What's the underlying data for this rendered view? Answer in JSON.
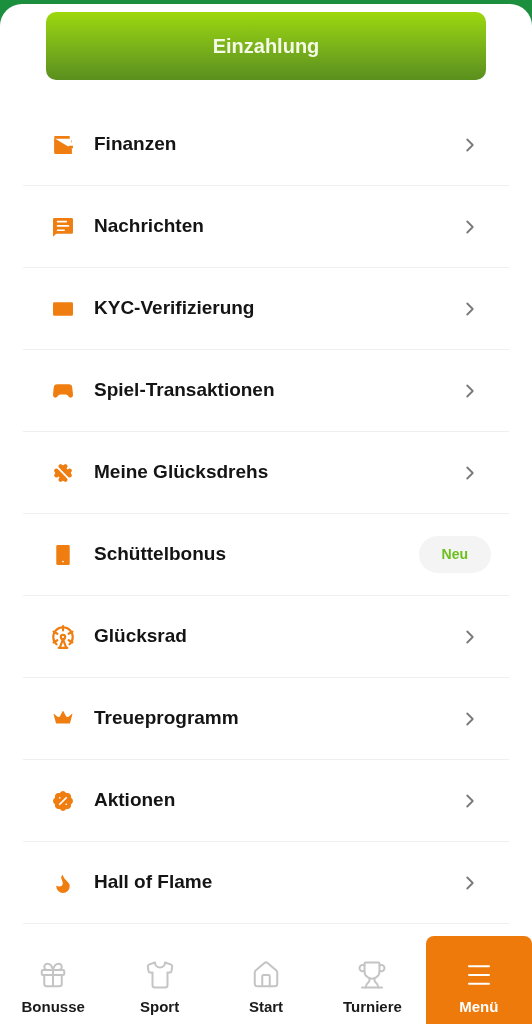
{
  "deposit_button": {
    "label": "Einzahlung"
  },
  "menu_items": [
    {
      "label": "Finanzen",
      "kind": "link"
    },
    {
      "label": "Nachrichten",
      "kind": "link"
    },
    {
      "label": "KYC-Verifizierung",
      "kind": "link"
    },
    {
      "label": "Spiel-Transaktionen",
      "kind": "link"
    },
    {
      "label": "Meine Glücksdrehs",
      "kind": "link"
    },
    {
      "label": "Schüttelbonus",
      "kind": "badge",
      "badge": "Neu"
    },
    {
      "label": "Glücksrad",
      "kind": "link"
    },
    {
      "label": "Treueprogramm",
      "kind": "link"
    },
    {
      "label": "Aktionen",
      "kind": "link"
    },
    {
      "label": "Hall of Flame",
      "kind": "link"
    }
  ],
  "bottom_nav": [
    {
      "label": "Bonusse",
      "selected": false
    },
    {
      "label": "Sport",
      "selected": false
    },
    {
      "label": "Start",
      "selected": false
    },
    {
      "label": "Turniere",
      "selected": false
    },
    {
      "label": "Menü",
      "selected": true
    }
  ]
}
